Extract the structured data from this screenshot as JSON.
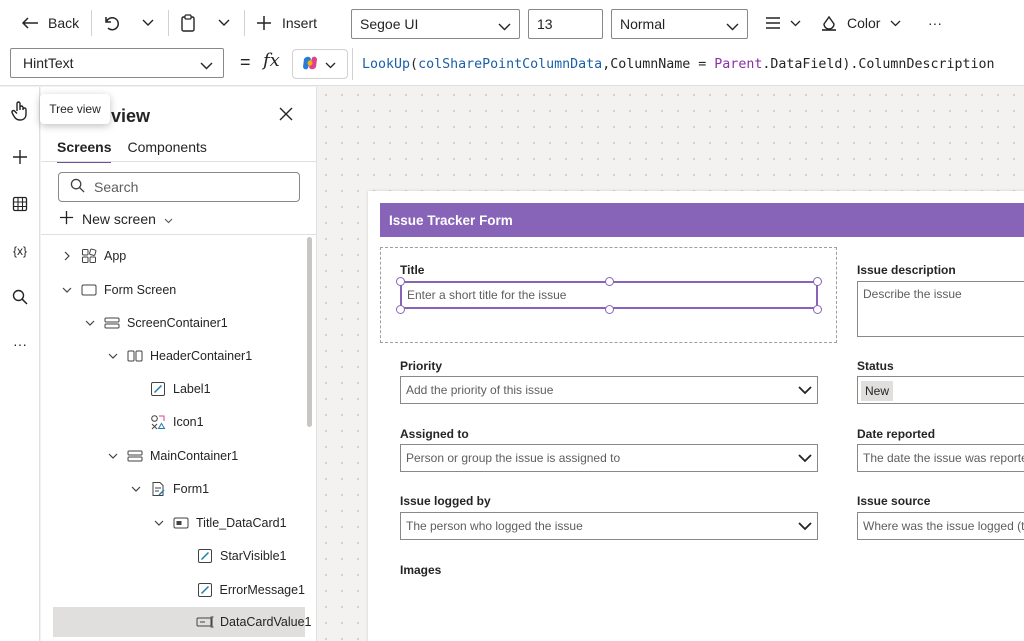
{
  "toolbar": {
    "back_label": "Back",
    "insert_label": "Insert",
    "font": "Segoe UI",
    "font_size": "13",
    "font_weight": "Normal",
    "color_label": "Color",
    "more_label": "···"
  },
  "formula_bar": {
    "property": "HintText",
    "equals": "=",
    "fx": "fx",
    "formula": {
      "fn": "LookUp",
      "open": "(",
      "arg1": "colSharePointColumnData",
      "comma": ",",
      "field": "ColumnName",
      "op": " = ",
      "parent": "Parent",
      "rest": ".DataField).ColumnDescription"
    }
  },
  "rail": {
    "tooltip": "Tree view",
    "variables_label": "{x}",
    "more_label": "···"
  },
  "tree_panel": {
    "title": "view",
    "tabs": [
      "Screens",
      "Components"
    ],
    "search_placeholder": "Search",
    "new_screen_label": "New screen",
    "items": [
      {
        "label": "App"
      },
      {
        "label": "Form Screen"
      },
      {
        "label": "ScreenContainer1"
      },
      {
        "label": "HeaderContainer1"
      },
      {
        "label": "Label1"
      },
      {
        "label": "Icon1"
      },
      {
        "label": "MainContainer1"
      },
      {
        "label": "Form1"
      },
      {
        "label": "Title_DataCard1"
      },
      {
        "label": "StarVisible1"
      },
      {
        "label": "ErrorMessage1"
      },
      {
        "label": "DataCardValue1"
      }
    ]
  },
  "form": {
    "header": "Issue Tracker Form",
    "fields": {
      "title": {
        "label": "Title",
        "placeholder": "Enter a short title for the issue"
      },
      "description": {
        "label": "Issue description",
        "placeholder": "Describe the issue"
      },
      "priority": {
        "label": "Priority",
        "placeholder": "Add the priority of this issue"
      },
      "status": {
        "label": "Status",
        "value": "New"
      },
      "assigned": {
        "label": "Assigned to",
        "placeholder": "Person or group the issue is assigned to"
      },
      "date": {
        "label": "Date reported",
        "placeholder": "The date the issue was reported"
      },
      "logged_by": {
        "label": "Issue logged by",
        "placeholder": "The person who logged the issue"
      },
      "source": {
        "label": "Issue source",
        "placeholder": "Where was the issue logged (ticket"
      },
      "images": {
        "label": "Images"
      }
    }
  },
  "colors": {
    "accent": "#8764b8",
    "tab_underline": "#6c4fa0"
  }
}
